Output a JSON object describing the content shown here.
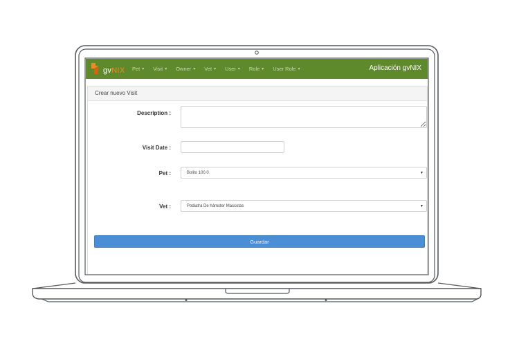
{
  "brand": {
    "logo_text_main": "gv",
    "logo_text_accent": "NIX"
  },
  "navbar": {
    "items": [
      {
        "label": "Pet"
      },
      {
        "label": "Visit"
      },
      {
        "label": "Owner"
      },
      {
        "label": "Vet"
      },
      {
        "label": "User"
      },
      {
        "label": "Role"
      },
      {
        "label": "User Role"
      }
    ],
    "app_title": "Aplicación gvNIX"
  },
  "panel": {
    "title": "Crear nuevo Visit"
  },
  "form": {
    "description_label": "Description :",
    "description_value": "",
    "visit_date_label": "Visit Date :",
    "visit_date_value": "",
    "pet_label": "Pet :",
    "pet_selected": "Bolito 100.0",
    "vet_label": "Vet :",
    "vet_selected": "Podiatra De hámster Mascotas",
    "submit_label": "Guardar"
  },
  "colors": {
    "navbar_bg": "#5e8a2c",
    "logo_accent": "#f08a24",
    "button_bg": "#4a8fd6"
  }
}
